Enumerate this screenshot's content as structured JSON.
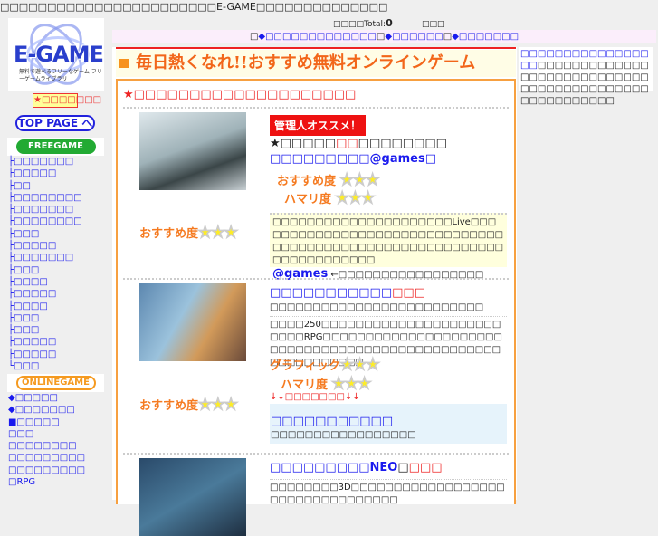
{
  "header": {
    "top_text": "□□□□□□□□□□□□□□□□□□□□□□□E-GAME□□□□□□□□□□□□□□",
    "counter_label": "□□",
    "counter_sub": "□□Total:",
    "counter_value": "0",
    "counter_suffix": "□□□",
    "nav": {
      "prefix": "□",
      "items": [
        "◆□□□□□□□□□□□□□",
        "◆□□□□□□",
        "◆□□□□□□□"
      ]
    }
  },
  "sidebar": {
    "logo_text": "E-GAME",
    "logo_tagline": "無料で遊べるフリーなゲーム フリーゲームライブラリ",
    "new_label": "★□□□□□□□",
    "top_page": "TOP PAGE へ",
    "freegame": "FREEGAME",
    "free_items": [
      "├□□□□□□□",
      "├□□□□□",
      "├□□",
      "├□□□□□□□□",
      "├□□□□□□□",
      "├□□□□□□□□",
      "├□□□",
      "├□□□□□",
      "├□□□□□□□",
      "├□□□",
      "├□□□□",
      "├□□□□□",
      "├□□□□",
      "├□□□",
      "├□□□",
      "├□□□□□",
      "├□□□□□",
      "└□□□"
    ],
    "onlinegame": "ONLINEGAME",
    "online_items": [
      "◆□□□□□",
      "◆□□□□□□□",
      "■□□□□□",
      "□□□",
      "□□□□□□□□",
      "□□□□□□□□□",
      "□□□□□□□□□",
      "□RPG"
    ]
  },
  "main": {
    "title": "毎日熱くなれ!!おすすめ無料オンラインゲーム",
    "section_heading": "★□□□□□□□□□□□□□□□□□□□□",
    "games": [
      {
        "badge": "管理人オススメ！",
        "line1_a": "★□□□□□",
        "line1_b": "□□",
        "line1_c": "□□□□□□□□",
        "name": "□□□□□□□□□@games□",
        "rating1_label": "おすすめ度",
        "rating2_label": "ハマリ度",
        "stars": 3,
        "side_label": "おすすめ度",
        "desc": "□□□□□□□□□□□□□□□□□□□□□Live□□□□□□□□□□□□□□□□□□□□□□□□□□□□□□□□□□□□□□□□□□□□□□□□□□□□□□□□□□□□□□□□□□□□□",
        "link": "@games",
        "link_note": "←□□□□□□□□□□□□□□□□□"
      },
      {
        "name": "□□□□□□□□□□□",
        "name_tag": "□□□",
        "sub": "□□□□□□□□□□□□□□□□□□□□□□□□□",
        "desc": "□□□□250□□□□□□□□□□□□□□□□□□□□□□□□□RPG□□□□□□□□□□□□□□□□□□□□□□□□□□□□□□□□□□□□□□□□□□□□□□□□□□□□□□□□□□□",
        "rating1_label": "グラフィック",
        "rating2_label": "ハマリ度",
        "side_label": "おすすめ度",
        "arrow_note": "↓↓□□□□□□□↓↓",
        "sub_link": "□□□□□□□□□□□",
        "sub_link_note": "□□□□□□□□□□□□□□□□□"
      },
      {
        "name": "□□□□□□□□□NEO",
        "sep": "□",
        "name_tag": "□□□",
        "desc": "□□□□□□□□3D□□□□□□□□□□□□□□□□□□□□□□□□□□□□□□□□□"
      }
    ]
  },
  "right": {
    "link": "□□□□□□□□□□□□□□□□□",
    "text": "□□□□□□□□□□□□□□□□□□□□□□□□□□□□□□□□□□□□□□□□□□□□□□□□□□□□□□"
  },
  "colors": {
    "accent_orange": "#f7921e",
    "title_text": "#f2661a",
    "link": "#1a1aee",
    "red": "#ee1111"
  }
}
